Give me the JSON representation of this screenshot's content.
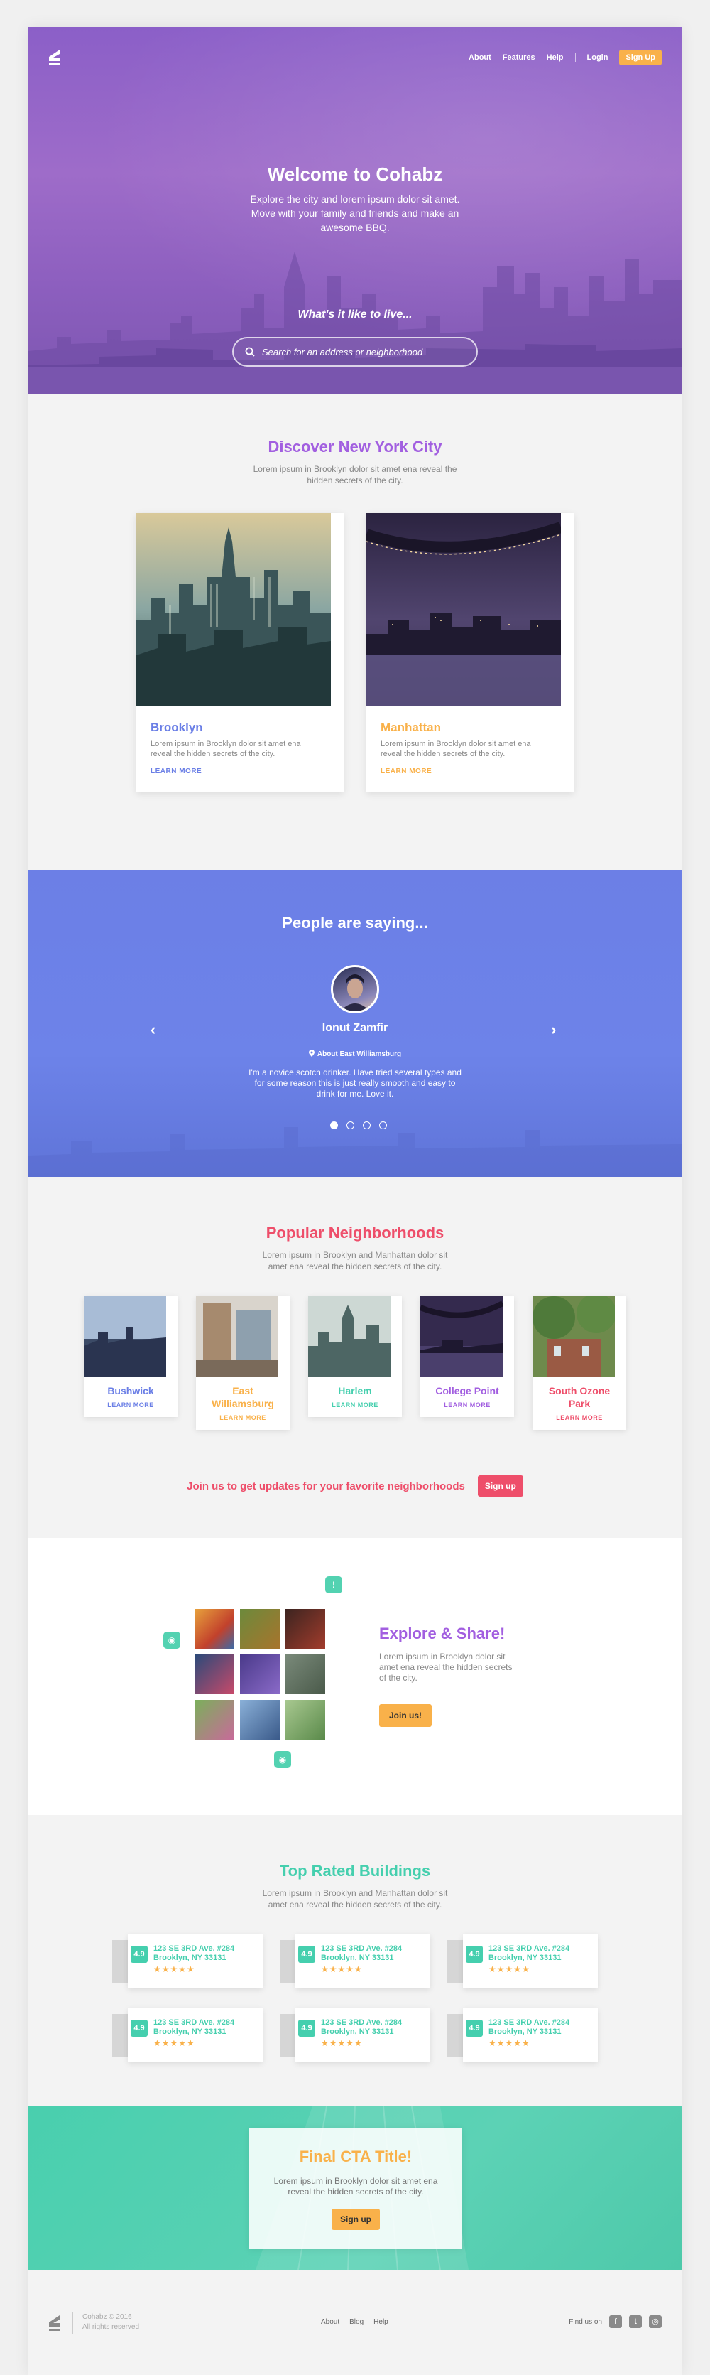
{
  "colors": {
    "purple": "#a25fe0",
    "orange": "#f9b14a",
    "blue": "#6b7fe6",
    "pink": "#ee4e6a",
    "teal": "#45cfae"
  },
  "header": {
    "nav": [
      "About",
      "Features",
      "Help"
    ],
    "login": "Login",
    "signup": "Sign Up"
  },
  "hero": {
    "title": "Welcome to Cohabz",
    "subtitle": "Explore the city and lorem ipsum dolor sit amet. Move with your family and friends and make an awesome BBQ.",
    "question": "What's it like to live...",
    "search_placeholder": "Search for an address or neighborhood"
  },
  "discover": {
    "title": "Discover New York City",
    "subtitle": "Lorem ipsum in Brooklyn dolor sit amet ena reveal the hidden secrets of the city.",
    "cards": [
      {
        "name": "Brooklyn",
        "text": "Lorem ipsum in Brooklyn dolor sit amet ena reveal the hidden secrets of the city.",
        "link": "LEARN MORE",
        "color": "#6b7fe6"
      },
      {
        "name": "Manhattan",
        "text": "Lorem ipsum in Brooklyn dolor sit amet ena reveal the hidden secrets of the city.",
        "link": "LEARN MORE",
        "color": "#f9b14a"
      }
    ]
  },
  "testimonials": {
    "title": "People are saying...",
    "name": "Ionut Zamfir",
    "about": "About East Williamsburg",
    "quote": "I'm a novice scotch drinker. Have tried several types and for some reason this is just really smooth and easy to drink for me. Love it.",
    "prev_icon": "chevron-left-icon",
    "next_icon": "chevron-right-icon",
    "slide_count": 4,
    "active_slide": 1
  },
  "neighborhoods": {
    "title": "Popular Neighborhoods",
    "subtitle": "Lorem ipsum in Brooklyn and Manhattan dolor sit amet ena reveal the hidden secrets of the city.",
    "items": [
      {
        "name": "Bushwick",
        "link": "LEARN MORE",
        "color": "#6b7fe6"
      },
      {
        "name": "East Williamsburg",
        "link": "LEARN MORE",
        "color": "#f9b14a"
      },
      {
        "name": "Harlem",
        "link": "LEARN MORE",
        "color": "#45cfae"
      },
      {
        "name": "College Point",
        "link": "LEARN MORE",
        "color": "#a25fe0"
      },
      {
        "name": "South Ozone Park",
        "link": "LEARN MORE",
        "color": "#ee4e6a"
      }
    ],
    "join_text": "Join us to get updates for your favorite neighborhoods",
    "join_button": "Sign up"
  },
  "explore": {
    "title": "Explore & Share!",
    "subtitle": "Lorem ipsum in Brooklyn dolor sit amet ena reveal the hidden secrets of the city.",
    "button": "Join us!"
  },
  "buildings": {
    "title": "Top Rated Buildings",
    "subtitle": "Lorem ipsum in Brooklyn and Manhattan dolor sit amet ena reveal the hidden secrets of the city.",
    "items": [
      {
        "score": "4.9",
        "line1": "123 SE 3RD Ave. #284",
        "line2": "Brooklyn, NY 33131",
        "stars": "★★★★★"
      },
      {
        "score": "4.9",
        "line1": "123 SE 3RD Ave. #284",
        "line2": "Brooklyn, NY 33131",
        "stars": "★★★★★"
      },
      {
        "score": "4.9",
        "line1": "123 SE 3RD Ave. #284",
        "line2": "Brooklyn, NY 33131",
        "stars": "★★★★★"
      },
      {
        "score": "4.9",
        "line1": "123 SE 3RD Ave. #284",
        "line2": "Brooklyn, NY 33131",
        "stars": "★★★★★"
      },
      {
        "score": "4.9",
        "line1": "123 SE 3RD Ave. #284",
        "line2": "Brooklyn, NY 33131",
        "stars": "★★★★★"
      },
      {
        "score": "4.9",
        "line1": "123 SE 3RD Ave. #284",
        "line2": "Brooklyn, NY 33131",
        "stars": "★★★★★"
      }
    ]
  },
  "cta": {
    "title": "Final CTA Title!",
    "text": "Lorem ipsum in Brooklyn dolor sit amet ena reveal the hidden secrets of the city.",
    "button": "Sign up"
  },
  "footer": {
    "copyright": "Cohabz © 2016",
    "rights": "All rights reserved",
    "links": [
      "About",
      "Blog",
      "Help"
    ],
    "find_us": "Find us on",
    "social": [
      "facebook-icon",
      "twitter-icon",
      "instagram-icon"
    ]
  }
}
